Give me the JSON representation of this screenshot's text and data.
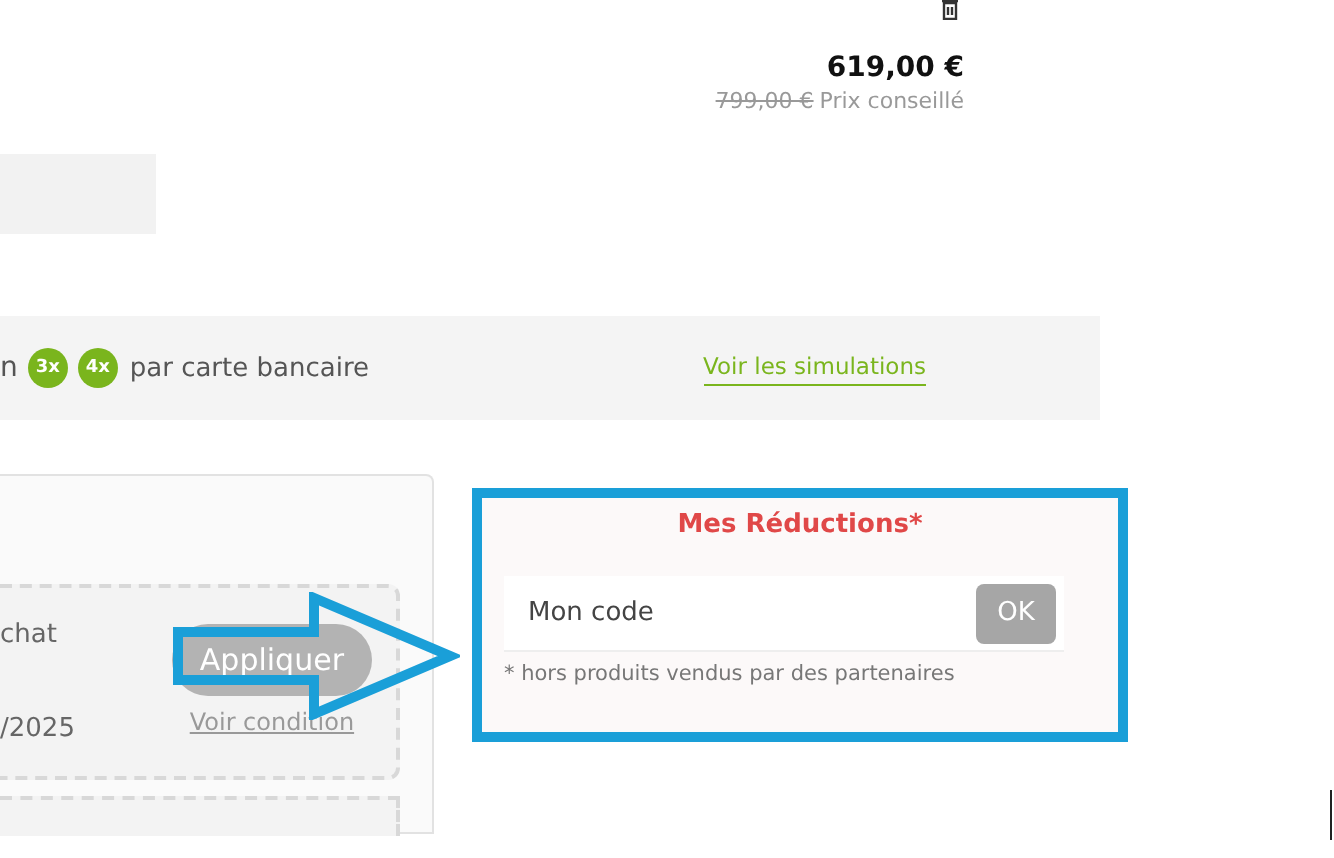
{
  "cart_item": {
    "price": "619,00 €",
    "old_price": "799,00 €",
    "old_price_label": "Prix conseillé"
  },
  "payment": {
    "text_fragment": "n",
    "badges": [
      "3x",
      "4x"
    ],
    "text": "par carte bancaire",
    "link": "Voir les simulations"
  },
  "offer_card": {
    "text_fragment": "chat",
    "date_fragment": "/2025",
    "apply_button": "Appliquer",
    "condition_link": "Voir condition"
  },
  "promo": {
    "title": "Mes Réductions*",
    "placeholder": "Mon code",
    "ok_button": "OK",
    "note": "* hors produits vendus par des partenaires"
  }
}
